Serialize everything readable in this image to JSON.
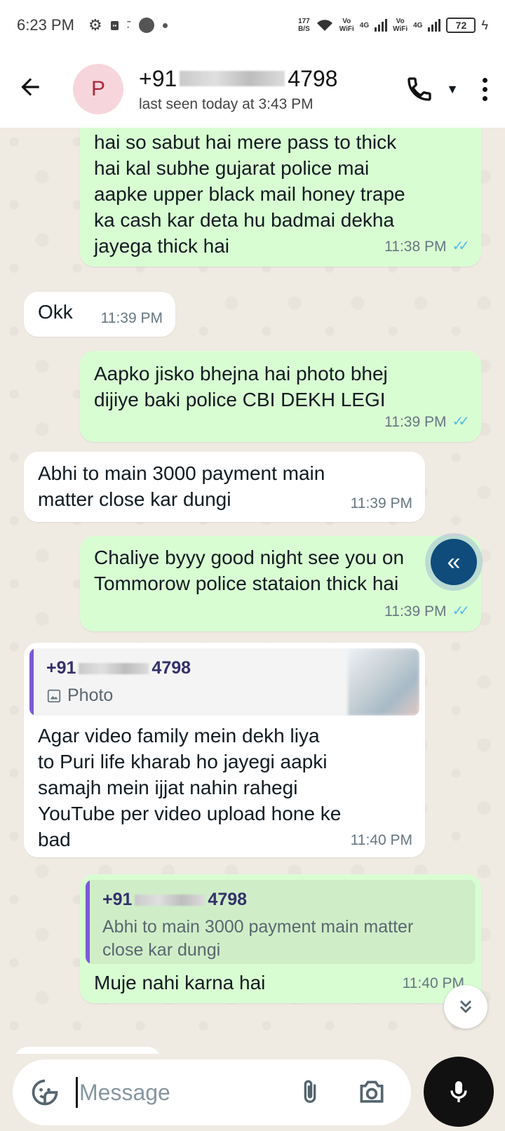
{
  "status_bar": {
    "time": "6:23 PM",
    "net_speed_top": "177",
    "net_speed_bottom": "B/S",
    "volte1_top": "Vo",
    "volte1_bottom": "WiFi",
    "network1": "4G",
    "volte2_top": "Vo",
    "volte2_bottom": "WiFi",
    "network2": "4G",
    "battery": "72"
  },
  "header": {
    "avatar_letter": "P",
    "contact_prefix": "+91",
    "contact_suffix": "4798",
    "last_seen": "last seen today at 3:43 PM"
  },
  "messages": [
    {
      "text": "hai so sabut hai mere pass to thick\nhai kal subhe gujarat police mai\naapke upper black mail honey trape\nka cash kar deta hu badmai dekha\njayega thick hai",
      "time": "11:38 PM"
    },
    {
      "text": "Okk",
      "time": "11:39 PM"
    },
    {
      "text": "Aapko jisko bhejna hai photo bhej\ndijiye baki police CBI DEKH LEGI",
      "time": "11:39 PM"
    },
    {
      "text": "Abhi to main 3000 payment main\nmatter close kar dungi",
      "time": "11:39 PM"
    },
    {
      "text": "Chaliye byyy good night see you on\nTommorow police stataion thick hai",
      "time": "11:39 PM"
    },
    {
      "quote_author_prefix": "+91",
      "quote_author_suffix": "4798",
      "quote_text": "Photo",
      "text": "Agar video family mein dekh liya\nto Puri life kharab ho jayegi aapki\nsamajh mein ijjat nahin rahegi\nYouTube per video upload hone ke\nbad",
      "time": "11:40 PM"
    },
    {
      "quote_author_prefix": "+91",
      "quote_author_suffix": "4798",
      "quote_text": "Abhi to main 3000 payment main matter\nclose kar dungi",
      "text": "Muje nahi karna hai",
      "time": "11:40 PM"
    }
  ],
  "input": {
    "placeholder": "Message"
  },
  "colors": {
    "outgoing_bubble": "#d9fdd3",
    "incoming_bubble": "#ffffff",
    "read_ticks": "#53bdeb",
    "chat_background": "#efeae2"
  },
  "icons": {
    "back": "arrow-left-icon",
    "call": "phone-icon",
    "menu": "more-vert-icon",
    "emoji": "sticker-icon",
    "attach": "paperclip-icon",
    "camera": "camera-icon",
    "mic": "microphone-icon",
    "scroll": "double-chevron-down-icon",
    "floating": "double-chevron-left-icon"
  }
}
